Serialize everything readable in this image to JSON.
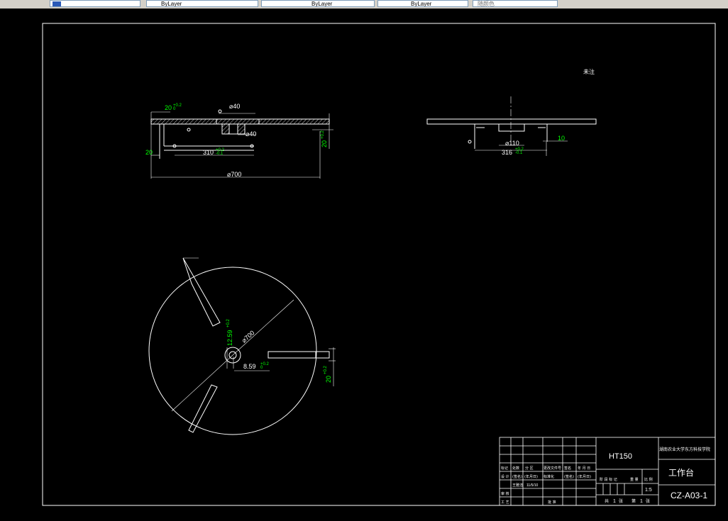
{
  "toolbar": {
    "fields": [
      {
        "label": "",
        "icon": "layer-icon"
      },
      {
        "label": "ByLayer"
      },
      {
        "label": "ByLayer"
      },
      {
        "label": "ByLayer"
      },
      {
        "label": "随颜色"
      }
    ]
  },
  "drawing": {
    "note_mark": "未注",
    "front_view": {
      "dim_top_left": "20",
      "dim_top_left_tol": "+0.2\n0",
      "dim_phi40_top": "⌀40",
      "dim_phi40_bottom": "⌀40",
      "dim_left": "20",
      "dim_slot": "310",
      "dim_slot_tol": "+0.2\n-0.1",
      "dim_right": "20",
      "dim_right_tol": "+0.2\n0",
      "dim_overall": "⌀700"
    },
    "side_view": {
      "dim_hub": "⌀110",
      "dim_width": "316",
      "dim_width_tol": "+0.2\n-0.1",
      "dim_gap": "10"
    },
    "plan_view": {
      "dim_diameter": "⌀700",
      "dim_keyway_v": "12.59",
      "dim_keyway_v_tol": "+0.2\n0",
      "dim_keyway_h": "8.59",
      "dim_keyway_h_tol": "+0.2\n0",
      "dim_slot_width": "20",
      "dim_slot_width_tol": "+0.2\n0"
    },
    "title_block": {
      "material": "HT150",
      "school": "湖南农业大学东方科技学院",
      "part_name": "工作台",
      "drawing_no": "CZ-A03-1",
      "scale": "1:5",
      "sheet_total": "1",
      "sheet_num": "1",
      "row_labels": {
        "mark": "标记",
        "count": "处数",
        "zone": "分 区",
        "change_doc": "更改文件号",
        "sign": "签名",
        "date": "年 月 日",
        "design": "设 计",
        "sign_name": "(签名)",
        "date_value": "11/5/10",
        "standard": "标准化",
        "sign2": "(签名)",
        "date2": "(年月日)",
        "review": "审 核",
        "process": "工 艺",
        "approve": "批 准",
        "stage": "阶 段 标 记",
        "weight": "重 量",
        "ratio": "比 例",
        "total_label": "共",
        "sheet_label": "张",
        "num_label": "第",
        "num_sheet_label": "张",
        "designer": "王雅洁"
      }
    }
  },
  "colors": {
    "line": "#ffffff",
    "dim_text": "#00ff00",
    "dim_line": "#ffffff",
    "bg": "#000000",
    "hatch": "#ffffff"
  }
}
